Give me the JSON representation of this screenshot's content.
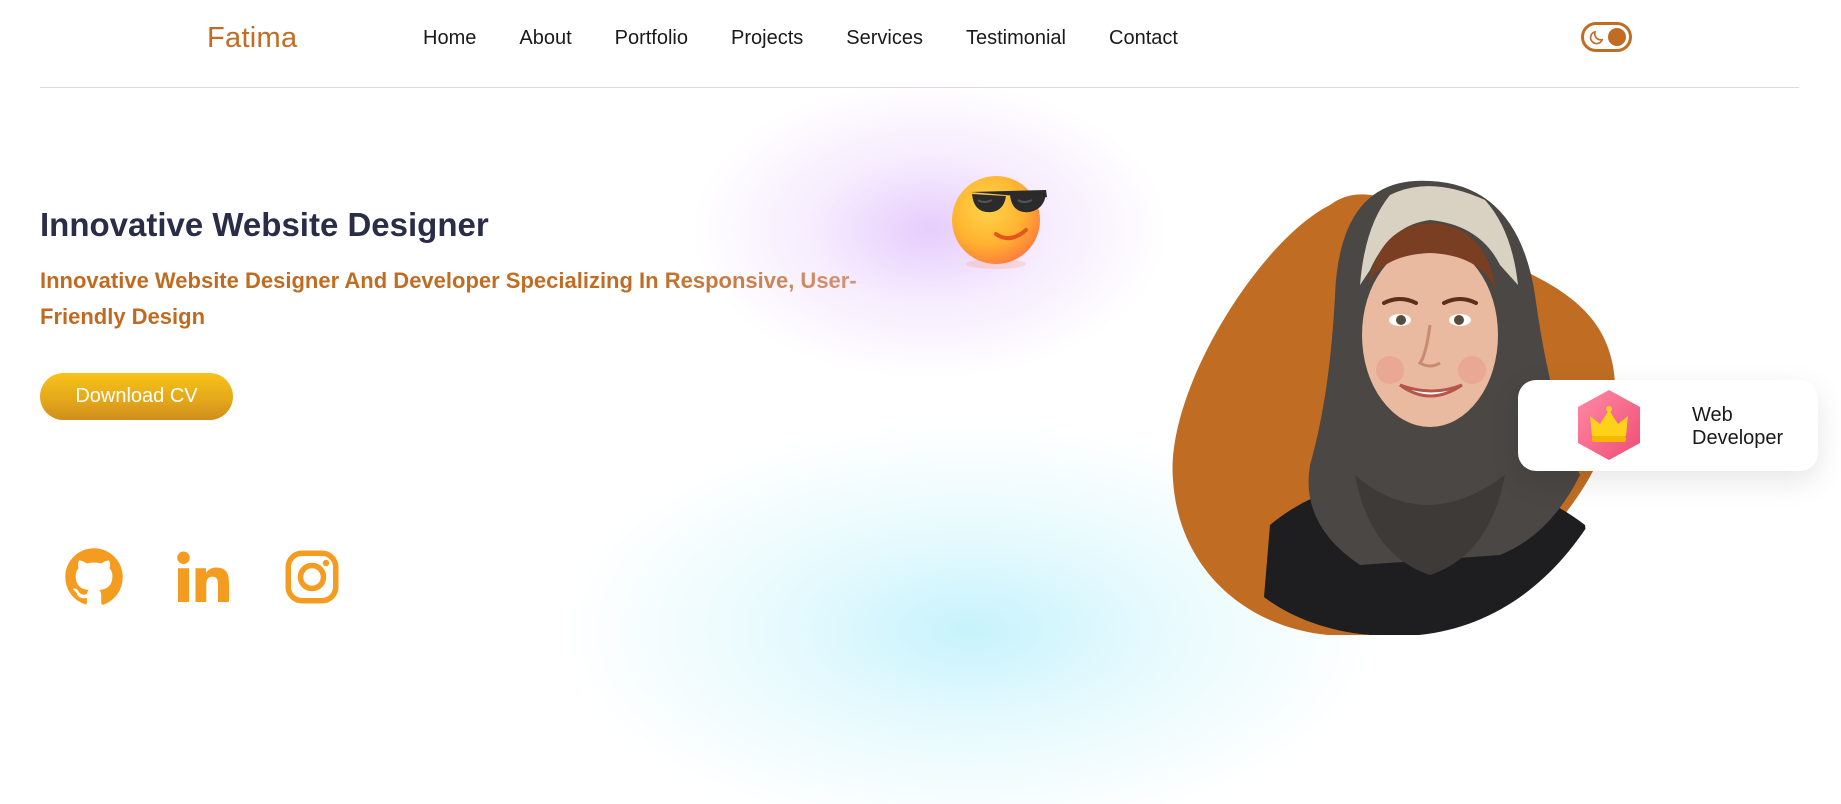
{
  "header": {
    "logo": "Fatima",
    "nav": [
      "Home",
      "About",
      "Portfolio",
      "Projects",
      "Services",
      "Testimonial",
      "Contact"
    ],
    "theme_toggle_icon": "moon-icon"
  },
  "hero": {
    "title": "Innovative Website Designer",
    "subtitle": "Innovative Website Designer And Developer Specializing In Responsive, User-Friendly Design",
    "cta_label": "Download CV"
  },
  "social": [
    {
      "icon": "github-icon"
    },
    {
      "icon": "linkedin-icon"
    },
    {
      "icon": "instagram-icon"
    }
  ],
  "badge": {
    "icon": "crown-icon",
    "label": "Web Developer"
  },
  "colors": {
    "accent": "#c06d23",
    "social": "#f39c1f",
    "heading": "#2a2d48",
    "button": "#f2b81a"
  }
}
